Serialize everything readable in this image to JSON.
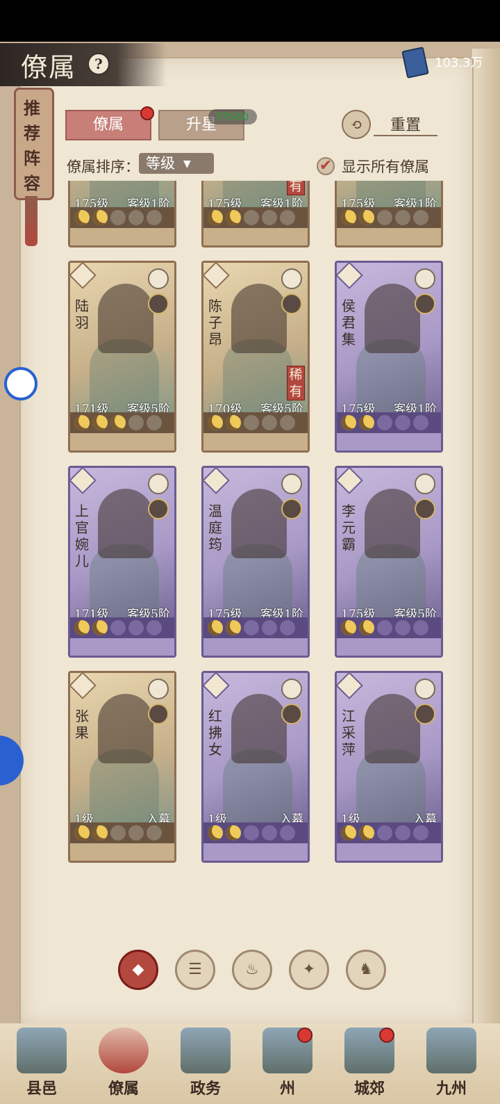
{
  "header": {
    "title": "僚属",
    "help_icon": "question-icon",
    "currency_icon": "book-icon",
    "currency_value": "103.3万"
  },
  "recommend_tab": {
    "label": "推荐阵容"
  },
  "tabs": [
    {
      "label": "僚属",
      "active": true,
      "has_dot": true
    },
    {
      "label": "升星",
      "active": false
    }
  ],
  "fps_overlay": "FPS60",
  "reset": {
    "label": "重置",
    "icon": "reset-icon"
  },
  "sort": {
    "label": "僚属排序：",
    "value": "等级"
  },
  "show_all": {
    "label": "显示所有僚属",
    "checked": true
  },
  "cards": [
    {
      "name": "",
      "level": "175级",
      "rank": "客级1阶",
      "moons": 2,
      "rarity": "",
      "style": "tan"
    },
    {
      "name": "",
      "level": "175级",
      "rank": "客级1阶",
      "moons": 2,
      "rarity": "稀有",
      "style": "tan"
    },
    {
      "name": "",
      "level": "175级",
      "rank": "客级1阶",
      "moons": 2,
      "rarity": "",
      "style": "tan"
    },
    {
      "name": "陆羽",
      "level": "171级",
      "rank": "客级5阶",
      "moons": 3,
      "rarity": "",
      "style": "tan"
    },
    {
      "name": "陈子昂",
      "level": "170级",
      "rank": "客级5阶",
      "moons": 2,
      "rarity": "稀有",
      "style": "tan"
    },
    {
      "name": "侯君集",
      "level": "175级",
      "rank": "客级1阶",
      "moons": 2,
      "rarity": "",
      "style": "purple"
    },
    {
      "name": "上官婉儿",
      "level": "171级",
      "rank": "客级5阶",
      "moons": 2,
      "rarity": "",
      "style": "purple"
    },
    {
      "name": "温庭筠",
      "level": "175级",
      "rank": "客级1阶",
      "moons": 2,
      "rarity": "",
      "style": "purple"
    },
    {
      "name": "李元霸",
      "level": "175级",
      "rank": "客级5阶",
      "moons": 2,
      "rarity": "",
      "style": "purple"
    },
    {
      "name": "张果",
      "level": "1级",
      "rank": "入幕",
      "moons": 2,
      "rarity": "",
      "style": "tan"
    },
    {
      "name": "红拂女",
      "level": "1级",
      "rank": "入幕",
      "moons": 2,
      "rarity": "",
      "style": "purple"
    },
    {
      "name": "江采萍",
      "level": "1级",
      "rank": "入幕",
      "moons": 2,
      "rarity": "",
      "style": "purple"
    }
  ],
  "filters": [
    {
      "icon": "all-diamond-icon",
      "active": true
    },
    {
      "icon": "scholar-icon",
      "active": false
    },
    {
      "icon": "gourd-icon",
      "active": false
    },
    {
      "icon": "fan-icon",
      "active": false
    },
    {
      "icon": "horse-icon",
      "active": false
    }
  ],
  "nav": [
    {
      "label": "县邑",
      "icon": "county-icon",
      "dot": false
    },
    {
      "label": "僚属",
      "icon": "members-icon",
      "dot": false,
      "active": true
    },
    {
      "label": "政务",
      "icon": "affairs-icon",
      "dot": false
    },
    {
      "label": "州",
      "icon": "prefecture-icon",
      "dot": true
    },
    {
      "label": "城郊",
      "icon": "suburb-icon",
      "dot": true
    },
    {
      "label": "九州",
      "icon": "map-icon",
      "dot": false
    }
  ]
}
